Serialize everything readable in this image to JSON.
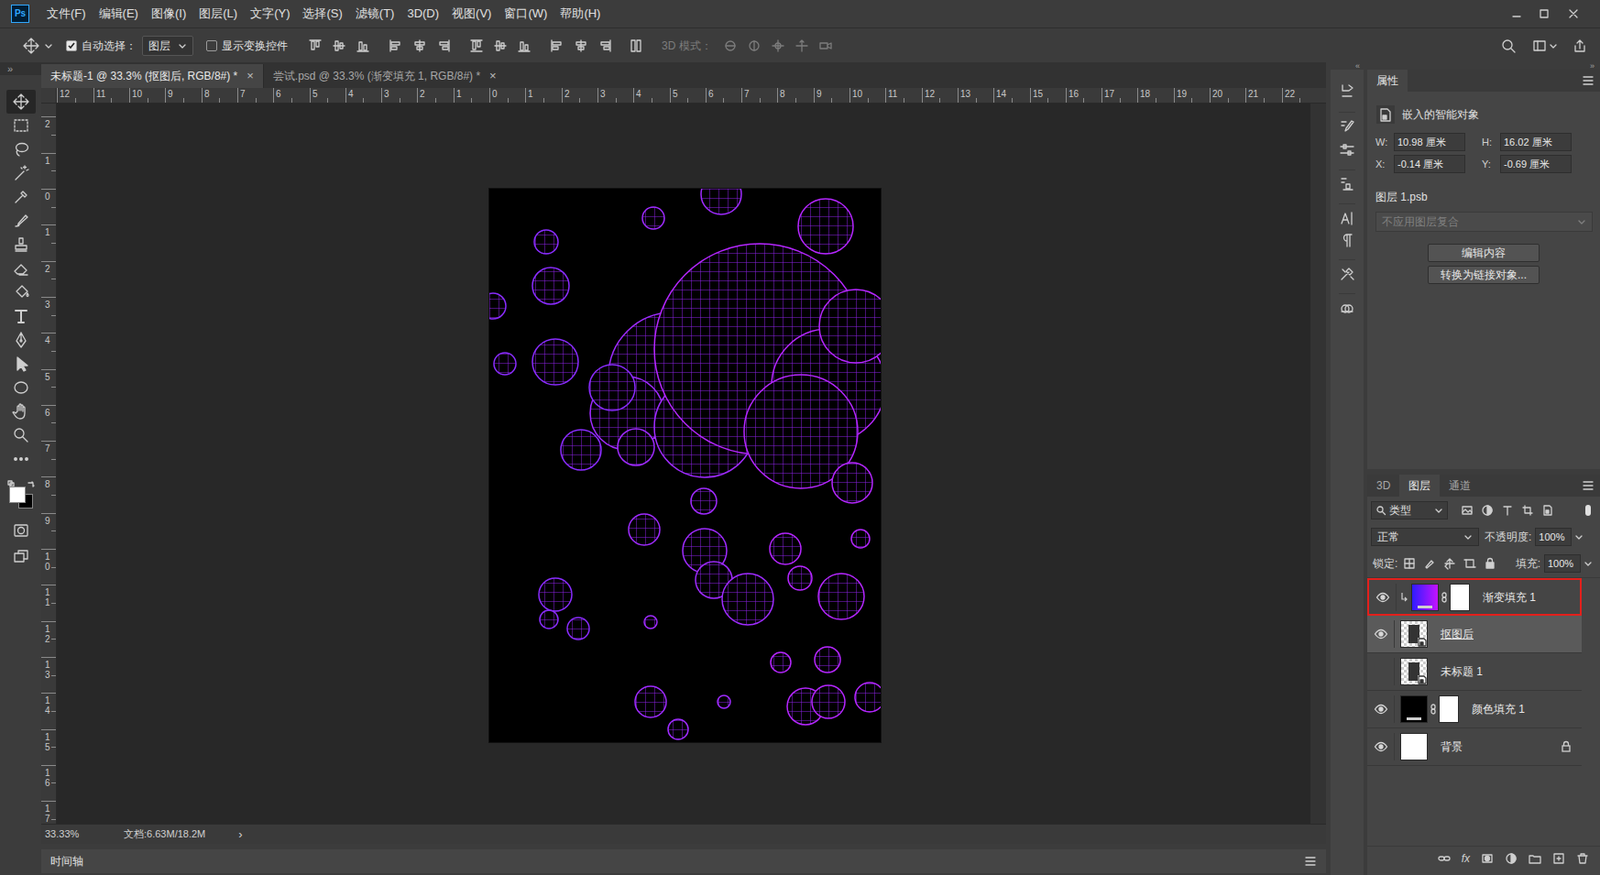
{
  "app": {
    "logo": "Ps"
  },
  "menu": [
    "文件(F)",
    "编辑(E)",
    "图像(I)",
    "图层(L)",
    "文字(Y)",
    "选择(S)",
    "滤镜(T)",
    "3D(D)",
    "视图(V)",
    "窗口(W)",
    "帮助(H)"
  ],
  "options_bar": {
    "auto_select": {
      "label": "自动选择：",
      "checked": true
    },
    "auto_select_target": "图层",
    "show_transform": {
      "label": "显示变换控件",
      "checked": false
    },
    "mode_3d": {
      "label": "3D 模式：",
      "disabled": true
    }
  },
  "toolbar": {
    "collapse": "»",
    "swatches": [
      {
        "name": "foreground",
        "color": "#ffffff"
      },
      {
        "name": "background",
        "color": "#000000"
      }
    ]
  },
  "doc_tabs": [
    {
      "label": "未标题-1 @ 33.3% (抠图后, RGB/8#) *",
      "selected": true,
      "close": "×"
    },
    {
      "label": "尝试.psd @ 33.3% (渐变填充 1, RGB/8#) *",
      "selected": false,
      "close": "×"
    }
  ],
  "rulers": {
    "horizontal": [
      "12",
      "11",
      "10",
      "9",
      "8",
      "7",
      "6",
      "5",
      "4",
      "3",
      "2",
      "1",
      "0",
      "1",
      "2",
      "3",
      "4",
      "5",
      "6",
      "7",
      "8",
      "9",
      "10",
      "11",
      "12",
      "13",
      "14",
      "15",
      "16",
      "17",
      "18",
      "19",
      "20",
      "21",
      "22"
    ],
    "vertical": [
      "2",
      "1",
      "0",
      "1",
      "2",
      "3",
      "4",
      "5",
      "6",
      "7",
      "8",
      "9",
      "10",
      "11",
      "12",
      "13",
      "14",
      "15",
      "16",
      "17"
    ]
  },
  "status_bar": {
    "zoom": "33.33%",
    "doc_size": "文档:6.63M/18.2M",
    "more": "›"
  },
  "timeline": {
    "label": "时间轴"
  },
  "panel_dock": {
    "icons_collapse": "«",
    "panels_collapse": "»"
  },
  "properties": {
    "tab": "属性",
    "type": "嵌入的智能对象",
    "fields": [
      {
        "label": "W:",
        "value": "10.98 厘米"
      },
      {
        "label": "H:",
        "value": "16.02 厘米"
      },
      {
        "label": "X:",
        "value": "-0.14 厘米"
      },
      {
        "label": "Y:",
        "value": "-0.69 厘米"
      }
    ],
    "file": "图层 1.psb",
    "layer_comp": {
      "value": "不应用图层复合",
      "disabled": true
    },
    "buttons": [
      "编辑内容",
      "转换为链接对象..."
    ]
  },
  "layers_panel": {
    "tabs": [
      {
        "label": "3D",
        "selected": false
      },
      {
        "label": "图层",
        "selected": true
      },
      {
        "label": "通道",
        "selected": false
      }
    ],
    "filter": "类型",
    "blend_mode": "正常",
    "opacity": {
      "label": "不透明度:",
      "value": "100%"
    },
    "lock_label": "锁定:",
    "fill": {
      "label": "填充:",
      "value": "100%"
    },
    "layers": [
      {
        "name": "渐变填充 1",
        "kind": "gradient",
        "visible": true,
        "selected": false,
        "highlighted": true,
        "clipped": true,
        "mask": true,
        "locked": false,
        "underlined": false
      },
      {
        "name": "抠图后",
        "kind": "smart",
        "visible": true,
        "selected": true,
        "highlighted": false,
        "clipped": false,
        "mask": false,
        "locked": false,
        "underlined": true
      },
      {
        "name": "未标题 1",
        "kind": "smart",
        "visible": false,
        "selected": false,
        "highlighted": false,
        "clipped": false,
        "mask": false,
        "locked": false,
        "underlined": false
      },
      {
        "name": "颜色填充 1",
        "kind": "fill",
        "visible": true,
        "selected": false,
        "highlighted": false,
        "clipped": false,
        "mask": true,
        "locked": false,
        "underlined": false
      },
      {
        "name": "背景",
        "kind": "background",
        "visible": true,
        "selected": false,
        "highlighted": false,
        "clipped": false,
        "mask": false,
        "locked": true,
        "underlined": false
      }
    ],
    "footer_fx": "fx"
  }
}
